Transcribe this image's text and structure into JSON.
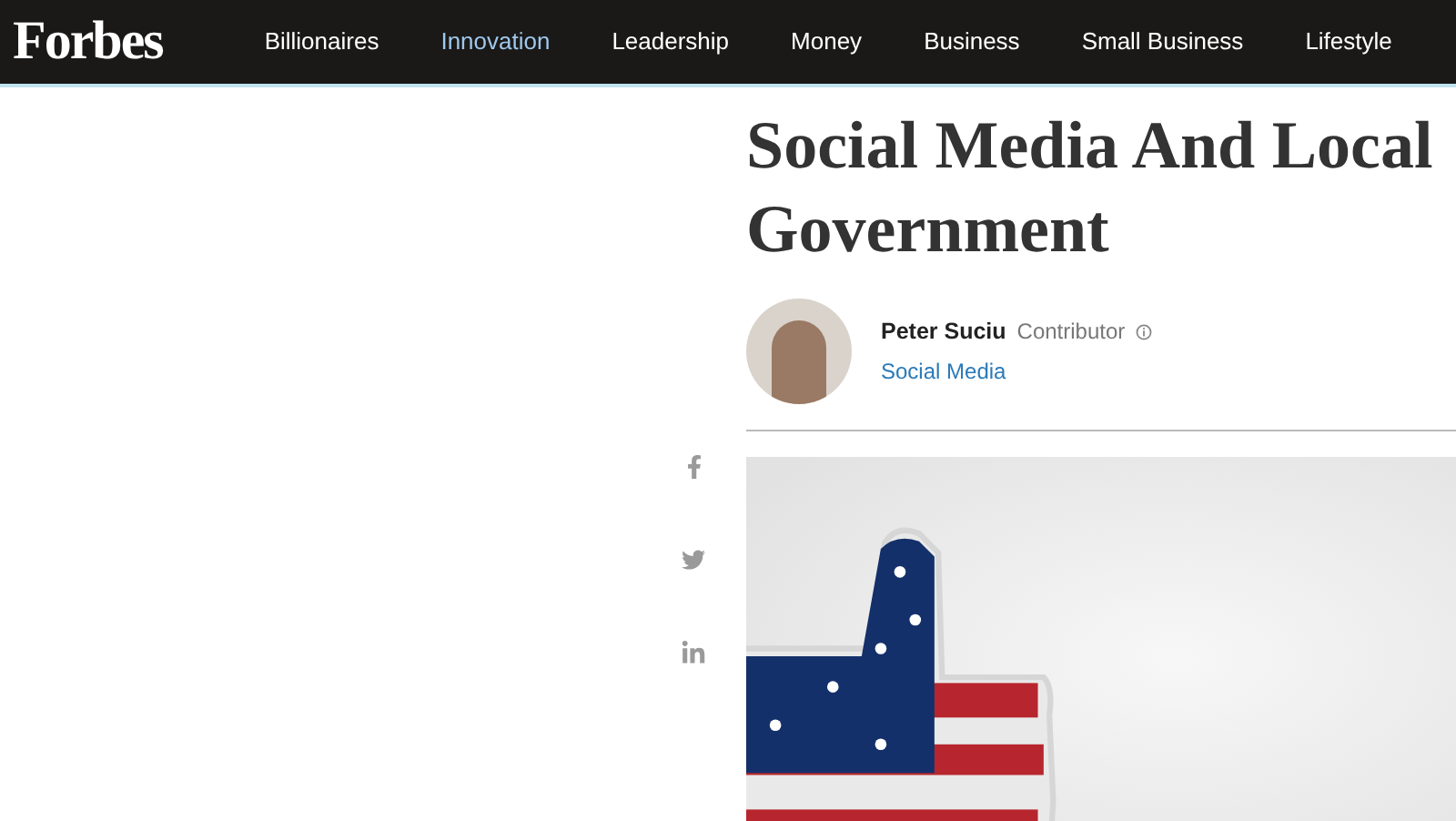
{
  "header": {
    "logo": "Forbes",
    "nav": [
      {
        "label": "Billionaires",
        "selected": false
      },
      {
        "label": "Innovation",
        "selected": true
      },
      {
        "label": "Leadership",
        "selected": false
      },
      {
        "label": "Money",
        "selected": false
      },
      {
        "label": "Business",
        "selected": false
      },
      {
        "label": "Small Business",
        "selected": false
      },
      {
        "label": "Lifestyle",
        "selected": false
      }
    ]
  },
  "article": {
    "title": "Social Media And Local Government",
    "author": {
      "name": "Peter Suciu",
      "role": "Contributor",
      "section": "Social Media"
    },
    "share": [
      {
        "kind": "facebook"
      },
      {
        "kind": "twitter"
      },
      {
        "kind": "linkedin"
      }
    ]
  }
}
